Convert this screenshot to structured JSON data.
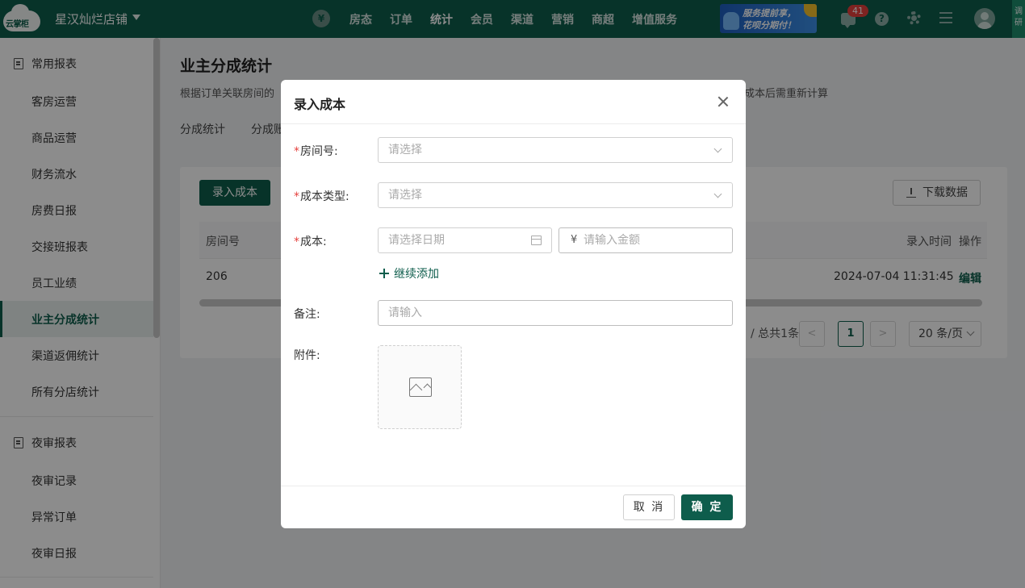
{
  "topbar": {
    "logo_text": "云掌柜",
    "store_name": "星汉灿烂店铺",
    "nav": [
      "房态",
      "订单",
      "统计",
      "会员",
      "渠道",
      "营销",
      "商超",
      "增值服务"
    ],
    "active_nav": "统计",
    "banner_line1": "服务提前享，",
    "banner_line2": "花呗分期付！",
    "message_count": "41",
    "help_glyph": "?",
    "side_tab": "调研"
  },
  "sidebar": {
    "group1": "常用报表",
    "items1": [
      "客房运营",
      "商品运营",
      "财务流水",
      "房费日报",
      "交接班报表",
      "员工业绩",
      "业主分成统计",
      "渠道返佣统计",
      "所有分店统计"
    ],
    "active_item": "业主分成统计",
    "group2": "夜审报表",
    "items2": [
      "夜审记录",
      "异常订单",
      "夜审日报"
    ]
  },
  "main": {
    "title": "业主分成统计",
    "desc_left": "根据订单关联房间的",
    "desc_right": "成本后需重新计算",
    "tabs": [
      "分成统计",
      "分成账"
    ],
    "add_cost_button": "录入成本",
    "download_button": "下载数据",
    "table": {
      "headers": {
        "room": "房间号",
        "entry_time": "录入时间",
        "actions": "操作"
      },
      "rows": [
        {
          "room": "206",
          "entry_time": "2024-07-04 11:31:45",
          "action": "编辑"
        }
      ]
    },
    "pager": {
      "total": "/ 总共1条",
      "current": "1",
      "prev": "<",
      "next": ">",
      "page_size": "20 条/页"
    }
  },
  "modal": {
    "title": "录入成本",
    "close_glyph": "X",
    "fields": {
      "room_label": "房间号:",
      "room_placeholder": "请选择",
      "cost_type_label": "成本类型:",
      "cost_type_placeholder": "请选择",
      "cost_label": "成本:",
      "date_placeholder": "请选择日期",
      "currency_symbol": "¥",
      "amount_placeholder": "请输入金额",
      "add_more": "继续添加",
      "remark_label": "备注:",
      "remark_placeholder": "请输入",
      "attachment_label": "附件:"
    },
    "required_mark": "*",
    "cancel_button": "取 消",
    "ok_button": "确 定"
  },
  "colors": {
    "brand": "#0e5d4c",
    "required": "#e5403d",
    "badge": "#e5403d"
  }
}
